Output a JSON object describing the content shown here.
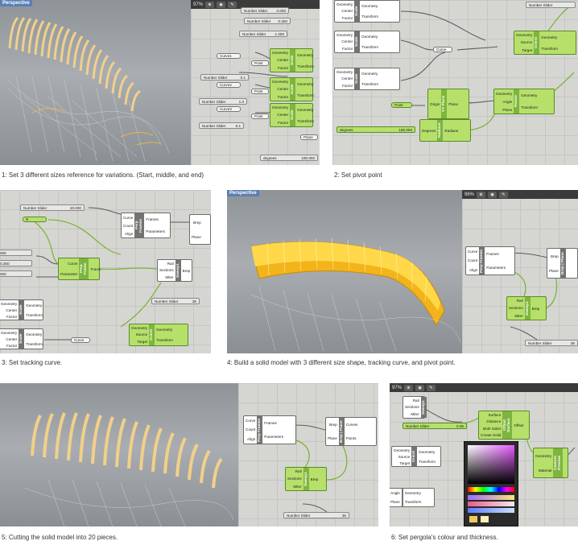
{
  "captions": {
    "c1": "1: Set 3 different sizes reference for variations. (Start, middle, and end)",
    "c2": "2: Set pivot point",
    "c3": "3: Set tracking curve.",
    "c4": "4: Build a solid model with 3 different size shape, tracking curve, and pivot point.",
    "c5": "5: Cutting the solid model into 20 pieces.",
    "c6": "6: Set pergola's colour and thickness."
  },
  "viewport_label": "Perspective",
  "zoom_values": {
    "p1": "97%",
    "p4": "96%",
    "p6": "97%"
  },
  "panel1": {
    "sliders": [
      {
        "label": "Number Slider",
        "value": "0.000"
      },
      {
        "label": "Number Slider",
        "value": "0.250"
      },
      {
        "label": "Number Slider",
        "value": "1.000"
      },
      {
        "label": "Number Slider",
        "value": "0.1"
      },
      {
        "label": "Number Slider",
        "value": "1.0"
      },
      {
        "label": "Number Slider",
        "value": "0.1"
      },
      {
        "label": "degrees",
        "value": "180.000"
      }
    ],
    "params": [
      "Curve1",
      "Point",
      "Curve2",
      "Point",
      "Curve3",
      "Point",
      "Plane"
    ],
    "scale_inputs": [
      "Geometry",
      "Center",
      "Factor"
    ],
    "scale_outputs": [
      "Geometry",
      "Transform"
    ],
    "scale_name": "Scale"
  },
  "panel2": {
    "scale_inputs": [
      "Geometry",
      "Center",
      "Factor"
    ],
    "scale_outputs": [
      "Geometry",
      "Transform"
    ],
    "scale_name": "Scale",
    "curve_param": "Curve",
    "point_param": "Point",
    "xy_plane": {
      "in": "Origin",
      "name": "XY Plane",
      "out": "Plane"
    },
    "orient": {
      "ins": [
        "Geometry",
        "Source",
        "Target"
      ],
      "name": "Orient",
      "outs": [
        "Geometry",
        "Transform"
      ]
    },
    "rotate": {
      "ins": [
        "Geometry",
        "Angle",
        "Plane"
      ],
      "name": "Rotate",
      "outs": [
        "Geometry",
        "Transform"
      ]
    },
    "radians": {
      "in": "Degrees",
      "name": "Radians",
      "out": "Radians"
    },
    "degree_slider": {
      "label": "degrees",
      "value": "180.000"
    },
    "top_slider": "Number Slider"
  },
  "panel3": {
    "sliders": [
      {
        "label": "Number Slider",
        "value": "20.000"
      },
      {
        "label": "Number Slider",
        "value": "36"
      }
    ],
    "left_values": [
      "000",
      "0.250",
      "000"
    ],
    "perp": {
      "ins": [
        "Curve",
        "Count",
        "Align"
      ],
      "name": "Perp Frames",
      "outs": [
        "Frames",
        "Parameters"
      ]
    },
    "perp2": {
      "ins": [
        "Curve",
        "Parameter"
      ],
      "name": "Perp Frame",
      "outs": [
        "Frame"
      ]
    },
    "sweep": {
      "ins": [
        "Rail",
        "Sections",
        "Miter"
      ],
      "name": "Sweep1",
      "outs": [
        "Brep"
      ]
    },
    "brep": {
      "ins": [
        "Brep",
        "Plane"
      ],
      "name": "Brep|Plane"
    },
    "scale": {
      "ins": [
        "Geometry",
        "Center",
        "Factor"
      ],
      "name": "Scale",
      "outs": [
        "Geometry",
        "Transform"
      ]
    },
    "orient": {
      "ins": [
        "Geometry",
        "Source",
        "Target"
      ],
      "name": "Orient",
      "outs": [
        "Geometry",
        "Transform"
      ]
    },
    "curve_param": "Curve",
    "n_param": "N"
  },
  "panel4": {
    "perp": {
      "ins": [
        "Curve",
        "Count",
        "Align"
      ],
      "name": "Perp Frames",
      "outs": [
        "Frames",
        "Parameters"
      ]
    },
    "brep": {
      "ins": [
        "Brep",
        "Plane"
      ],
      "name": "Brep | Plane",
      "out": "Cu"
    },
    "sweep": {
      "ins": [
        "Rail",
        "Sections",
        "Miter"
      ],
      "name": "Sweep1",
      "outs": [
        "Brep"
      ]
    },
    "slider": {
      "label": "Number Slider",
      "value": "36"
    }
  },
  "panel5": {
    "perp": {
      "ins": [
        "Curve",
        "Count",
        "Align"
      ],
      "name": "Perp Frames",
      "outs": [
        "Frames",
        "Parameters"
      ]
    },
    "brep": {
      "ins": [
        "Brep",
        "Plane"
      ],
      "name": "Brep | Plane",
      "outs": [
        "Curves",
        "Points"
      ]
    },
    "sweep": {
      "ins": [
        "Rail",
        "Sections",
        "Miter"
      ],
      "name": "Sweep1",
      "outs": [
        "Brep"
      ]
    },
    "slider": {
      "label": "Number Slider",
      "value": "36"
    }
  },
  "panel6": {
    "sweep": {
      "ins": [
        "Rail",
        "Sections",
        "Miter"
      ],
      "name": "Sweep1"
    },
    "slider": {
      "label": "Number Slider",
      "value": "0.08"
    },
    "offset": {
      "ins": [
        "Surface",
        "Distance",
        "Both Sides",
        "Create Solid"
      ],
      "name": "Offset Surface",
      "out": "Offset"
    },
    "orient": {
      "ins": [
        "Geometry",
        "Source",
        "Target"
      ],
      "name": "Orient",
      "outs": [
        "Geometry",
        "Transform"
      ]
    },
    "rotate": {
      "ins": [
        "Angle",
        "Plane"
      ],
      "outs": [
        "Geometry",
        "Transform"
      ]
    },
    "custom": {
      "ins": [
        "Geometry",
        "Material"
      ],
      "name": "Custom Preview"
    }
  }
}
